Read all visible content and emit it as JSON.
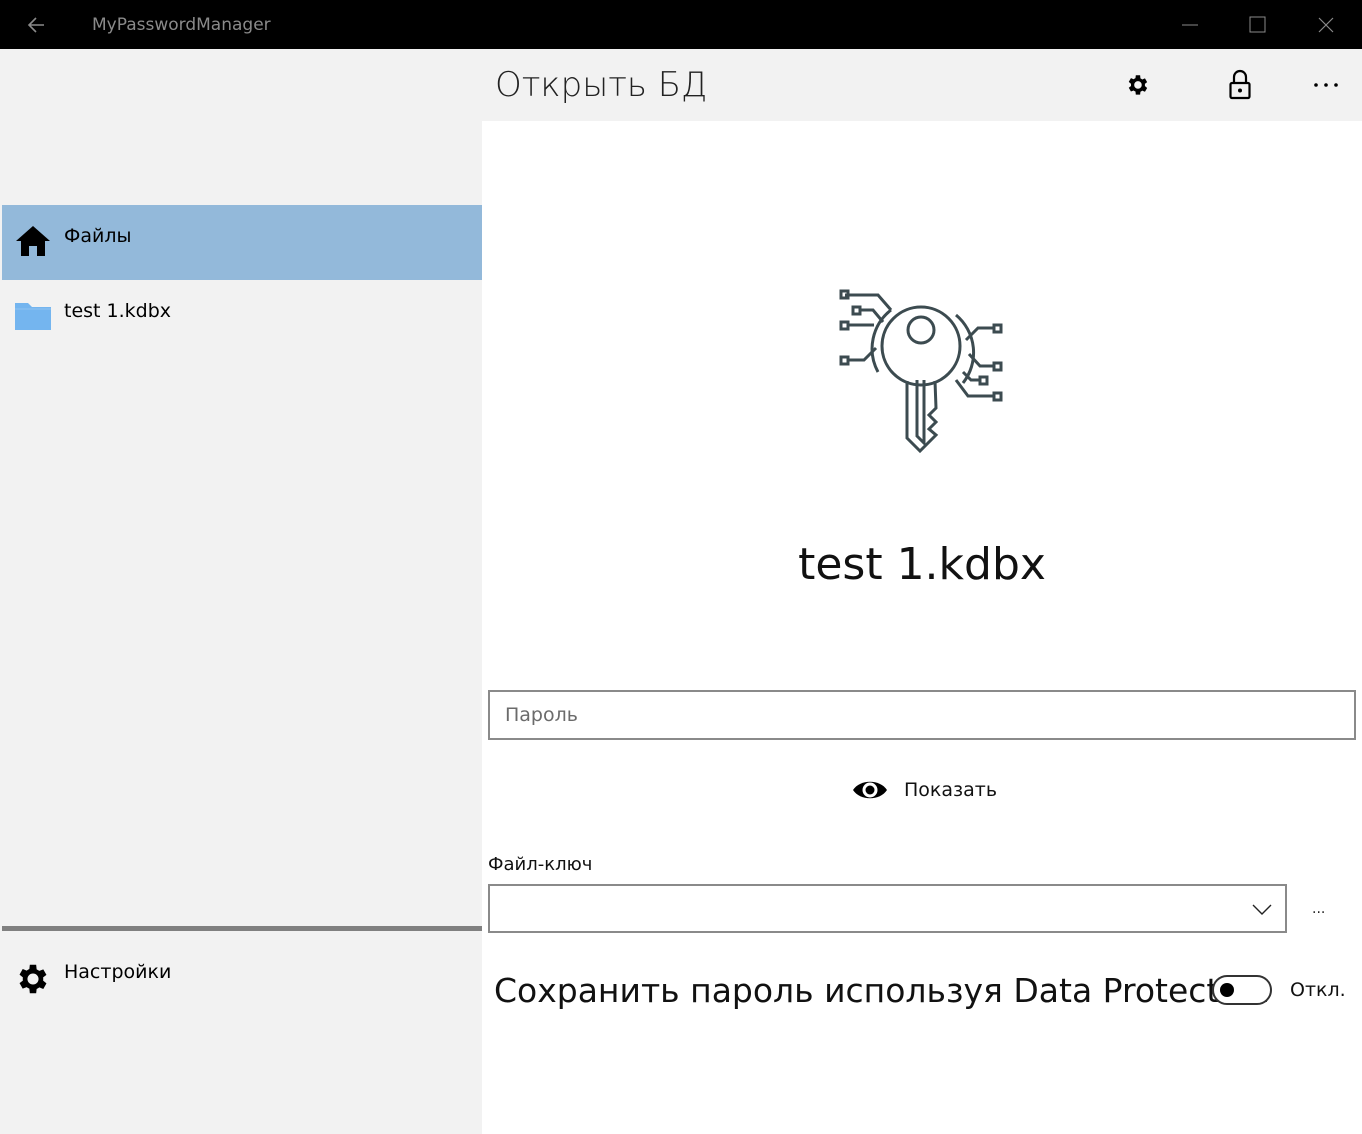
{
  "window": {
    "title": "MyPasswordManager",
    "controls": [
      "minimize-icon",
      "maximize-icon",
      "close-icon"
    ]
  },
  "sidebar": {
    "items": [
      {
        "label": "Файлы",
        "icon": "home-icon",
        "selected": true
      },
      {
        "label": "test 1.kdbx",
        "icon": "folder-icon",
        "selected": false
      }
    ],
    "footer_item": {
      "label": "Настройки",
      "icon": "gear-icon"
    }
  },
  "header": {
    "title": "Открыть БД",
    "actions": [
      "settings-icon",
      "lock-icon",
      "more-icon"
    ]
  },
  "main": {
    "db_name": "test 1.kdbx",
    "password_placeholder": "Пароль",
    "password_value": "",
    "show_label": "Показать",
    "keyfile_label": "Файл-ключ",
    "keyfile_value": "",
    "browse_label": "...",
    "dp_label": "Сохранить пароль используя Data Protection",
    "dp_state": "Откл.",
    "dp_enabled": false
  },
  "colors": {
    "selected_nav": "#93b9da",
    "folder": "#74b5ef",
    "titlebar": "#000000",
    "key_stroke": "#3c4b50"
  }
}
